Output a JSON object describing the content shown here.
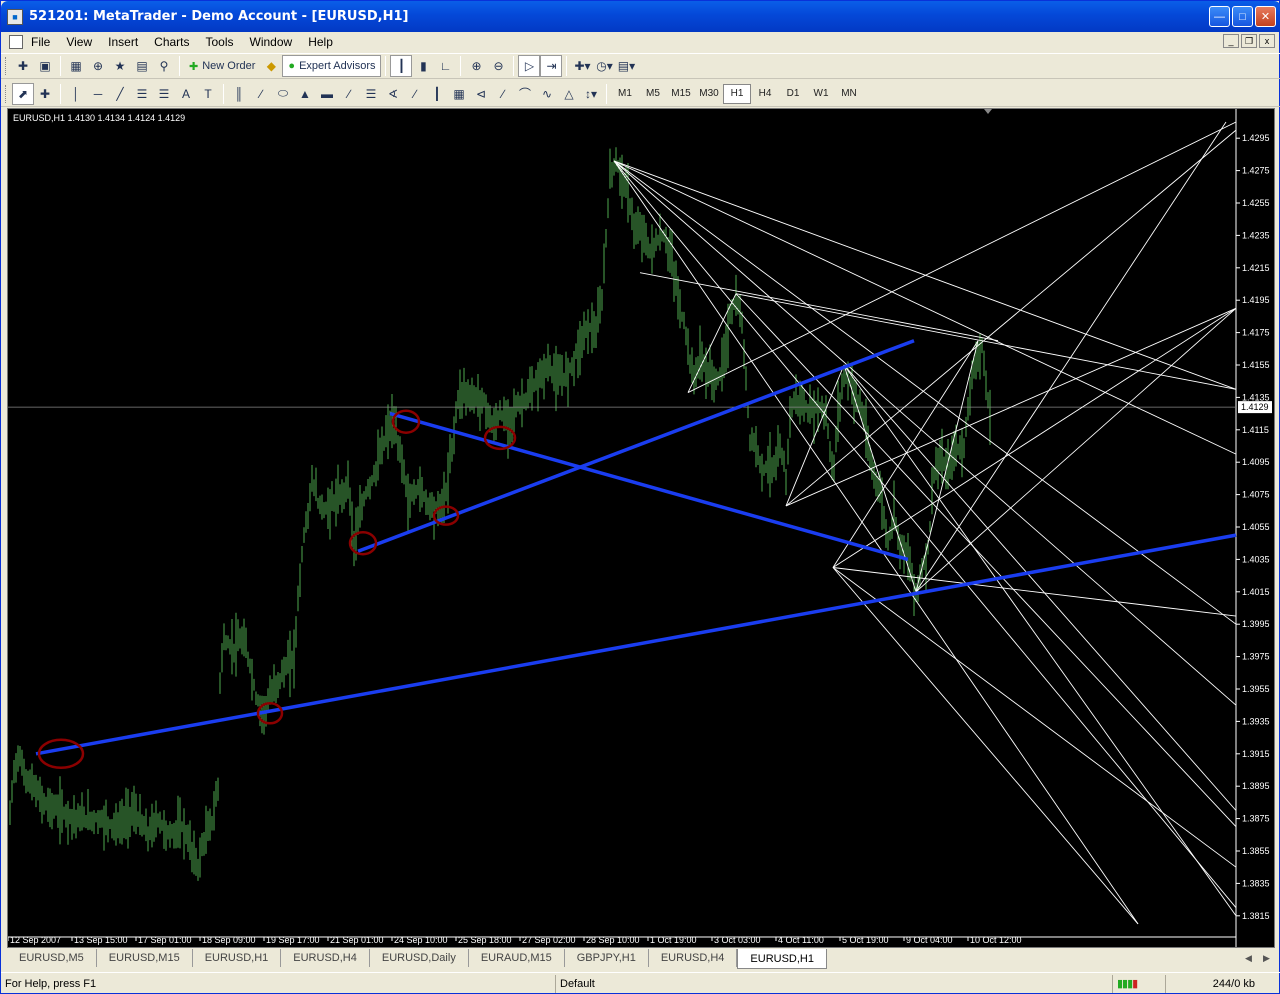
{
  "window": {
    "title": "521201: MetaTrader - Demo Account - [EURUSD,H1]"
  },
  "menu": [
    "File",
    "View",
    "Insert",
    "Charts",
    "Tools",
    "Window",
    "Help"
  ],
  "toolbar": {
    "new_order": "New Order",
    "expert_advisors": "Expert Advisors"
  },
  "timeframes": [
    "M1",
    "M5",
    "M15",
    "M30",
    "H1",
    "H4",
    "D1",
    "W1",
    "MN"
  ],
  "active_timeframe": "H1",
  "chart": {
    "header": "EURUSD,H1  1.4130 1.4134 1.4124 1.4129",
    "current_price": "1.4129",
    "colors": {
      "background": "#000000",
      "candles": "#4ea84e",
      "trendline": "#1a3df0",
      "marker": "#8b0000",
      "grid_lines": "#ffffff"
    },
    "price_labels": [
      "1.4295",
      "1.4275",
      "1.4255",
      "1.4235",
      "1.4215",
      "1.4195",
      "1.4175",
      "1.4155",
      "1.4135",
      "1.4115",
      "1.4095",
      "1.4075",
      "1.4055",
      "1.4035",
      "1.4015",
      "1.3995",
      "1.3975",
      "1.3955",
      "1.3935",
      "1.3915",
      "1.3895",
      "1.3875",
      "1.3855",
      "1.3835",
      "1.3815"
    ],
    "time_labels": [
      "12 Sep 2007",
      "13 Sep 15:00",
      "17 Sep 01:00",
      "18 Sep 09:00",
      "19 Sep 17:00",
      "21 Sep 01:00",
      "24 Sep 10:00",
      "25 Sep 18:00",
      "27 Sep 02:00",
      "28 Sep 10:00",
      "1 Oct 19:00",
      "3 Oct 03:00",
      "4 Oct 11:00",
      "5 Oct 19:00",
      "9 Oct 04:00",
      "10 Oct 12:00"
    ],
    "price_path": [
      [
        0,
        1.386
      ],
      [
        5,
        1.39
      ],
      [
        10,
        1.3915
      ],
      [
        18,
        1.39
      ],
      [
        25,
        1.3895
      ],
      [
        35,
        1.3885
      ],
      [
        50,
        1.388
      ],
      [
        70,
        1.3875
      ],
      [
        90,
        1.3875
      ],
      [
        110,
        1.387
      ],
      [
        125,
        1.388
      ],
      [
        140,
        1.3865
      ],
      [
        150,
        1.3875
      ],
      [
        160,
        1.3865
      ],
      [
        175,
        1.387
      ],
      [
        190,
        1.3845
      ],
      [
        195,
        1.386
      ],
      [
        205,
        1.3875
      ],
      [
        210,
        1.3895
      ],
      [
        212,
        1.396
      ],
      [
        215,
        1.3985
      ],
      [
        225,
        1.398
      ],
      [
        235,
        1.3985
      ],
      [
        242,
        1.397
      ],
      [
        248,
        1.395
      ],
      [
        255,
        1.394
      ],
      [
        262,
        1.395
      ],
      [
        270,
        1.396
      ],
      [
        280,
        1.397
      ],
      [
        286,
        1.3975
      ],
      [
        290,
        1.401
      ],
      [
        295,
        1.4045
      ],
      [
        300,
        1.4065
      ],
      [
        305,
        1.4085
      ],
      [
        310,
        1.407
      ],
      [
        318,
        1.4065
      ],
      [
        325,
        1.407
      ],
      [
        335,
        1.4075
      ],
      [
        340,
        1.4085
      ],
      [
        346,
        1.4045
      ],
      [
        350,
        1.4055
      ],
      [
        355,
        1.407
      ],
      [
        360,
        1.408
      ],
      [
        365,
        1.4085
      ],
      [
        370,
        1.4095
      ],
      [
        375,
        1.4105
      ],
      [
        380,
        1.4115
      ],
      [
        385,
        1.412
      ],
      [
        390,
        1.4105
      ],
      [
        395,
        1.4095
      ],
      [
        400,
        1.407
      ],
      [
        410,
        1.408
      ],
      [
        420,
        1.407
      ],
      [
        430,
        1.4065
      ],
      [
        438,
        1.4075
      ],
      [
        442,
        1.4095
      ],
      [
        446,
        1.4115
      ],
      [
        450,
        1.4135
      ],
      [
        456,
        1.414
      ],
      [
        462,
        1.4135
      ],
      [
        470,
        1.4135
      ],
      [
        478,
        1.413
      ],
      [
        485,
        1.4115
      ],
      [
        492,
        1.4125
      ],
      [
        500,
        1.412
      ],
      [
        510,
        1.413
      ],
      [
        520,
        1.4135
      ],
      [
        530,
        1.4145
      ],
      [
        540,
        1.4155
      ],
      [
        550,
        1.4145
      ],
      [
        560,
        1.415
      ],
      [
        570,
        1.4165
      ],
      [
        580,
        1.418
      ],
      [
        588,
        1.4175
      ],
      [
        594,
        1.4195
      ],
      [
        598,
        1.4235
      ],
      [
        602,
        1.427
      ],
      [
        606,
        1.428
      ],
      [
        612,
        1.4275
      ],
      [
        620,
        1.426
      ],
      [
        628,
        1.4235
      ],
      [
        635,
        1.424
      ],
      [
        640,
        1.4225
      ],
      [
        648,
        1.423
      ],
      [
        655,
        1.4235
      ],
      [
        662,
        1.4225
      ],
      [
        668,
        1.4205
      ],
      [
        672,
        1.419
      ],
      [
        678,
        1.4175
      ],
      [
        685,
        1.4145
      ],
      [
        692,
        1.416
      ],
      [
        700,
        1.415
      ],
      [
        710,
        1.4145
      ],
      [
        718,
        1.4165
      ],
      [
        722,
        1.4185
      ],
      [
        728,
        1.4195
      ],
      [
        734,
        1.418
      ],
      [
        738,
        1.4145
      ],
      [
        742,
        1.411
      ],
      [
        748,
        1.4105
      ],
      [
        755,
        1.409
      ],
      [
        762,
        1.4095
      ],
      [
        768,
        1.409
      ],
      [
        772,
        1.4105
      ],
      [
        778,
        1.4085
      ],
      [
        782,
        1.4125
      ],
      [
        788,
        1.4135
      ],
      [
        795,
        1.413
      ],
      [
        802,
        1.4125
      ],
      [
        810,
        1.413
      ],
      [
        818,
        1.4125
      ],
      [
        825,
        1.4085
      ],
      [
        830,
        1.4125
      ],
      [
        836,
        1.415
      ],
      [
        842,
        1.4145
      ],
      [
        848,
        1.4135
      ],
      [
        855,
        1.4125
      ],
      [
        862,
        1.4095
      ],
      [
        868,
        1.4085
      ],
      [
        874,
        1.407
      ],
      [
        880,
        1.4045
      ],
      [
        886,
        1.4065
      ],
      [
        892,
        1.4045
      ],
      [
        898,
        1.404
      ],
      [
        904,
        1.4025
      ],
      [
        908,
        1.4015
      ],
      [
        912,
        1.4025
      ],
      [
        918,
        1.4035
      ],
      [
        922,
        1.4055
      ],
      [
        926,
        1.409
      ],
      [
        932,
        1.4095
      ],
      [
        940,
        1.409
      ],
      [
        948,
        1.4105
      ],
      [
        955,
        1.41
      ],
      [
        960,
        1.413
      ],
      [
        965,
        1.415
      ],
      [
        970,
        1.4165
      ],
      [
        974,
        1.4165
      ],
      [
        978,
        1.414
      ],
      [
        982,
        1.4125
      ]
    ],
    "blue_lines": [
      [
        [
          28,
          1.3915
        ],
        [
          1228,
          1.405
        ]
      ],
      [
        [
          350,
          1.404
        ],
        [
          906,
          1.417
        ]
      ],
      [
        [
          382,
          1.4125
        ],
        [
          900,
          1.4035
        ]
      ]
    ],
    "markers": [
      [
        53,
        1.3915,
        22,
        14
      ],
      [
        262,
        1.394,
        12,
        10
      ],
      [
        355,
        1.4045,
        13,
        11
      ],
      [
        398,
        1.412,
        13,
        11
      ],
      [
        438,
        1.4062,
        12,
        9
      ],
      [
        492,
        1.411,
        15,
        11
      ]
    ],
    "white_lines": [
      [
        [
          606,
          1.4281
        ],
        [
          1228,
          1.414
        ]
      ],
      [
        [
          606,
          1.4281
        ],
        [
          1228,
          1.41
        ]
      ],
      [
        [
          606,
          1.4281
        ],
        [
          1228,
          1.3995
        ]
      ],
      [
        [
          606,
          1.4281
        ],
        [
          1228,
          1.3945
        ]
      ],
      [
        [
          606,
          1.4281
        ],
        [
          1130,
          1.381
        ]
      ],
      [
        [
          606,
          1.4281
        ],
        [
          1228,
          1.382
        ]
      ],
      [
        [
          632,
          1.4212
        ],
        [
          990,
          1.417
        ]
      ],
      [
        [
          680,
          1.4138
        ],
        [
          728,
          1.4199
        ]
      ],
      [
        [
          728,
          1.4199
        ],
        [
          1228,
          1.414
        ]
      ],
      [
        [
          728,
          1.4199
        ],
        [
          1228,
          1.387
        ]
      ],
      [
        [
          680,
          1.4138
        ],
        [
          1228,
          1.4305
        ]
      ],
      [
        [
          778,
          1.4068
        ],
        [
          1228,
          1.43
        ]
      ],
      [
        [
          778,
          1.4068
        ],
        [
          1228,
          1.419
        ]
      ],
      [
        [
          778,
          1.4068
        ],
        [
          836,
          1.4155
        ]
      ],
      [
        [
          825,
          1.403
        ],
        [
          970,
          1.417
        ]
      ],
      [
        [
          825,
          1.403
        ],
        [
          1228,
          1.419
        ]
      ],
      [
        [
          825,
          1.403
        ],
        [
          1228,
          1.4
        ]
      ],
      [
        [
          836,
          1.4155
        ],
        [
          1228,
          1.388
        ]
      ],
      [
        [
          908,
          1.4015
        ],
        [
          970,
          1.417
        ]
      ],
      [
        [
          908,
          1.4015
        ],
        [
          1218,
          1.4305
        ]
      ],
      [
        [
          908,
          1.4015
        ],
        [
          1228,
          1.419
        ]
      ],
      [
        [
          836,
          1.4155
        ],
        [
          908,
          1.4015
        ]
      ],
      [
        [
          825,
          1.403
        ],
        [
          1228,
          1.3845
        ]
      ],
      [
        [
          836,
          1.4155
        ],
        [
          1228,
          1.3815
        ]
      ],
      [
        [
          825,
          1.403
        ],
        [
          1130,
          1.381
        ]
      ]
    ]
  },
  "tabs": [
    "EURUSD,M5",
    "EURUSD,M15",
    "EURUSD,H1",
    "EURUSD,H4",
    "EURUSD,Daily",
    "EURAUD,M15",
    "GBPJPY,H1",
    "EURUSD,H4",
    "EURUSD,H1"
  ],
  "active_tab_index": 8,
  "status": {
    "help": "For Help, press F1",
    "profile": "Default",
    "traffic": "244/0 kb"
  }
}
